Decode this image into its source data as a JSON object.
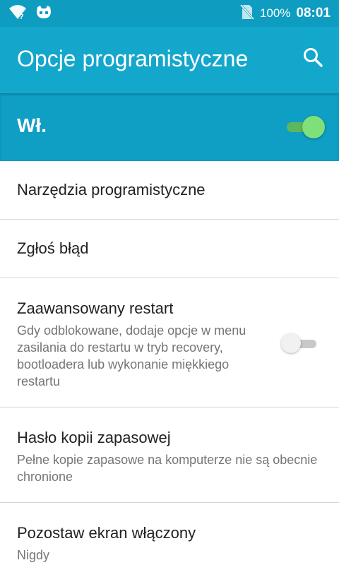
{
  "status_bar": {
    "battery_percent": "100%",
    "time": "08:01",
    "icons": [
      "wifi-unknown-icon",
      "cyanogen-mascot-icon",
      "no-sim-icon"
    ]
  },
  "app_bar": {
    "title": "Opcje programistyczne",
    "search_icon": "search-icon"
  },
  "master_switch": {
    "label": "Wł.",
    "on": true
  },
  "settings": [
    {
      "title": "Narzędzia programistyczne"
    },
    {
      "title": "Zgłoś błąd"
    },
    {
      "title": "Zaawansowany restart",
      "summary": "Gdy odblokowane, dodaje opcje w menu zasilania do restartu w tryb recovery, bootloadera lub wykonanie miękkiego restartu",
      "toggle_on": false
    },
    {
      "title": "Hasło kopii zapasowej",
      "summary": "Pełne kopie zapasowe na komputerze nie są obecnie chronione"
    },
    {
      "title": "Pozostaw ekran włączony",
      "summary": "Nigdy"
    }
  ],
  "colors": {
    "status_bar": "#0e9cc0",
    "app_bar": "#14a7cc",
    "switch_bar": "#0f9ec4",
    "switch_on_thumb": "#7fe07a",
    "switch_on_track": "#5db75d",
    "switch_off_thumb": "#f1f1f1",
    "switch_off_track": "#c8c8c8",
    "title_text": "#212121",
    "summary_text": "#757575"
  }
}
